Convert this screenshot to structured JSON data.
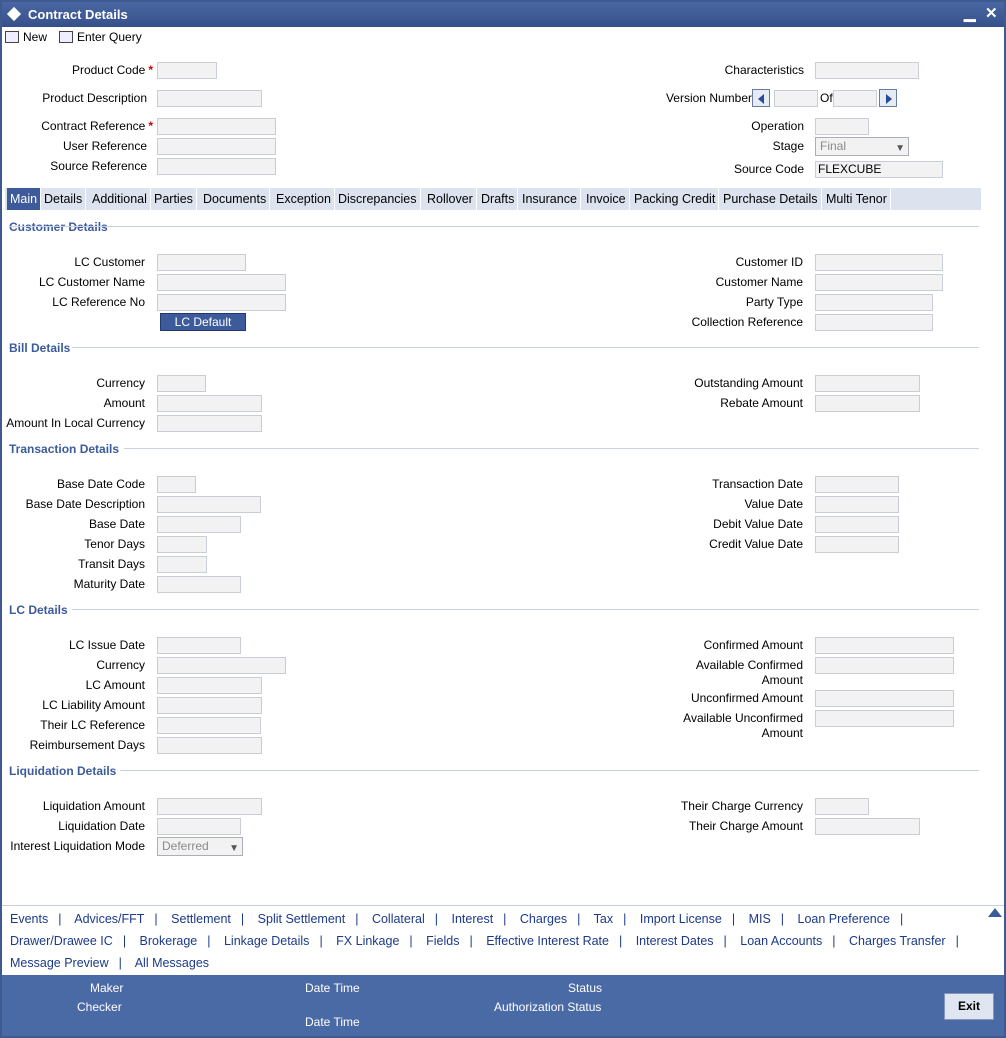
{
  "window": {
    "title": "Contract Details",
    "minimize": "▁",
    "close": "✕"
  },
  "toolbar": {
    "new_label": "New",
    "enter_query_label": "Enter Query"
  },
  "header": {
    "product_code": "Product Code",
    "product_description": "Product Description",
    "contract_reference": "Contract Reference",
    "user_reference": "User Reference",
    "source_reference": "Source Reference",
    "characteristics": "Characteristics",
    "version_number": "Version Number",
    "of": "Of",
    "operation": "Operation",
    "stage": "Stage",
    "stage_value": "Final",
    "source_code": "Source Code",
    "source_code_value": "FLEXCUBE",
    "required_mark": "*"
  },
  "tabs": [
    "Main",
    "Details",
    "Additional",
    "Parties",
    "Documents",
    "Exception",
    "Discrepancies",
    "Rollover",
    "Drafts",
    "Insurance",
    "Invoice",
    "Packing Credit",
    "Purchase Details",
    "Multi Tenor"
  ],
  "customer": {
    "title": "Customer Details",
    "lc_customer": "LC Customer",
    "lc_customer_name": "LC Customer Name",
    "lc_reference_no": "LC Reference No",
    "lc_default_button": "LC Default",
    "customer_id": "Customer ID",
    "customer_name": "Customer Name",
    "party_type": "Party Type",
    "collection_reference": "Collection Reference"
  },
  "bill": {
    "title": "Bill Details",
    "currency": "Currency",
    "amount": "Amount",
    "amount_local": "Amount In Local Currency",
    "outstanding_amount": "Outstanding Amount",
    "rebate_amount": "Rebate Amount"
  },
  "transaction": {
    "title": "Transaction Details",
    "base_date_code": "Base Date Code",
    "base_date_description": "Base Date Description",
    "base_date": "Base Date",
    "tenor_days": "Tenor Days",
    "transit_days": "Transit Days",
    "maturity_date": "Maturity Date",
    "transaction_date": "Transaction Date",
    "value_date": "Value Date",
    "debit_value_date": "Debit Value Date",
    "credit_value_date": "Credit Value Date"
  },
  "lc": {
    "title": "LC Details",
    "lc_issue_date": "LC Issue Date",
    "currency": "Currency",
    "lc_amount": "LC Amount",
    "lc_liability_amount": "LC Liability Amount",
    "their_lc_reference": "Their LC Reference",
    "reimbursement_days": "Reimbursement Days",
    "confirmed_amount": "Confirmed Amount",
    "available_confirmed_1": "Available Confirmed",
    "available_confirmed_2": "Amount",
    "unconfirmed_amount": "Unconfirmed Amount",
    "available_unconfirmed_1": "Available Unconfirmed",
    "available_unconfirmed_2": "Amount"
  },
  "liquidation": {
    "title": "Liquidation Details",
    "liquidation_amount": "Liquidation Amount",
    "liquidation_date": "Liquidation Date",
    "interest_liquidation_mode": "Interest Liquidation Mode",
    "interest_liquidation_value": "Deferred",
    "their_charge_currency": "Their Charge Currency",
    "their_charge_amount": "Their Charge Amount"
  },
  "links": {
    "row1": [
      "Events",
      "Advices/FFT",
      "Settlement",
      "Split Settlement",
      "Collateral",
      "Interest",
      "Charges",
      "Tax",
      "Import License",
      "MIS",
      "Loan Preference"
    ],
    "row2": [
      "Drawer/Drawee IC",
      "Brokerage",
      "Linkage Details",
      "FX Linkage",
      "Fields",
      "Effective Interest Rate",
      "Interest Dates",
      "Loan Accounts",
      "Charges Transfer"
    ],
    "row3": [
      "Message Preview",
      "All Messages"
    ]
  },
  "footer": {
    "maker": "Maker",
    "checker": "Checker",
    "date_time_1": "Date Time",
    "date_time_2": "Date Time",
    "status": "Status",
    "authorization_status": "Authorization Status",
    "exit": "Exit"
  }
}
